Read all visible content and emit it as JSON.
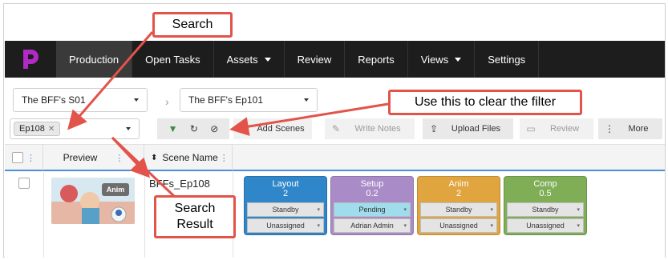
{
  "nav": {
    "items": [
      {
        "label": "Production"
      },
      {
        "label": "Open Tasks"
      },
      {
        "label": "Assets"
      },
      {
        "label": "Review"
      },
      {
        "label": "Reports"
      },
      {
        "label": "Views"
      },
      {
        "label": "Settings"
      }
    ]
  },
  "selectors": {
    "project": "The BFF's S01",
    "episode": "The BFF's Ep101",
    "filter_tag": "Ep108"
  },
  "toolbar": {
    "add_scenes": "Add Scenes",
    "write_notes": "Write Notes",
    "upload_files": "Upload Files",
    "review": "Review",
    "more": "More"
  },
  "table": {
    "headers": {
      "preview": "Preview",
      "scene_name": "Scene Name"
    },
    "row": {
      "thumb_badge": "Anim",
      "scene_name": "BFFs_Ep108",
      "tasks": [
        {
          "name": "Layout",
          "count": "2",
          "status": "Standby",
          "assignee": "Unassigned",
          "color": "#2f86c9",
          "status_bg": "#e4e4e4"
        },
        {
          "name": "Setup",
          "count": "0.2",
          "status": "Pending",
          "assignee": "Adrian Admin",
          "color": "#a98bc7",
          "status_bg": "#9fdcec"
        },
        {
          "name": "Anim",
          "count": "2",
          "status": "Standby",
          "assignee": "Unassigned",
          "color": "#e0a53f",
          "status_bg": "#e4e4e4"
        },
        {
          "name": "Comp",
          "count": "0.5",
          "status": "Standby",
          "assignee": "Unassigned",
          "color": "#7fae56",
          "status_bg": "#e4e4e4"
        }
      ]
    }
  },
  "annotations": {
    "search": "Search",
    "clear_filter": "Use this to clear the filter",
    "search_result_line1": "Search",
    "search_result_line2": "Result"
  },
  "colors": {
    "accent": "#4a90d9",
    "callout_border": "#e2534a",
    "navbar": "#1d1d1d",
    "logo": "#b02ac4"
  }
}
